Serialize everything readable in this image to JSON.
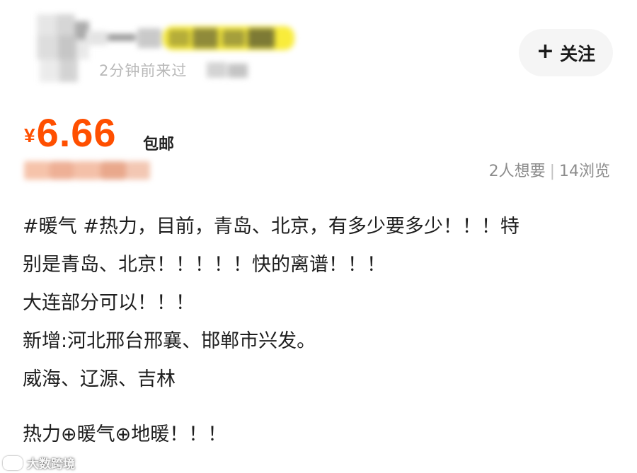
{
  "seller": {
    "name": "",
    "last_seen": "2分钟前来过",
    "follow_label": "关注",
    "follow_icon": "plus-icon"
  },
  "listing": {
    "currency_symbol": "¥",
    "price": "6.66",
    "shipping": "包邮",
    "wants": "2人想要",
    "views": "14浏览",
    "separator": "|"
  },
  "description": {
    "lines": [
      "#暖气  #热力，目前，青岛、北京，有多少要多少！！！特",
      "别是青岛、北京！！！！！快的离谱！！！",
      "大连部分可以！！！",
      "新增:河北邢台邢襄、邯郸市兴发。",
      "威海、辽源、吉林",
      "热力⊕暖气⊕地暖！！！"
    ]
  },
  "watermark": {
    "text": "大数跨境"
  },
  "colors": {
    "price": "#ff4f00",
    "highlight": "#f9ec3b",
    "muted_text": "#8c8c8c",
    "follow_button_bg": "#f5f5f5"
  }
}
